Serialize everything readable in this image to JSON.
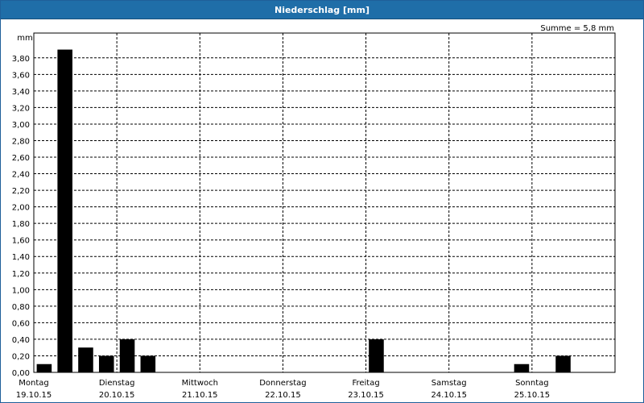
{
  "window": {
    "title": "Niederschlag [mm]"
  },
  "summary": "Summe = 5,8 mm",
  "chart_data": {
    "type": "bar",
    "title": "Niederschlag [mm]",
    "ylabel": "mm",
    "ylim": [
      0,
      4.1
    ],
    "yticks": [
      0,
      0.2,
      0.4,
      0.6,
      0.8,
      1.0,
      1.2,
      1.4,
      1.6,
      1.8,
      2.0,
      2.2,
      2.4,
      2.6,
      2.8,
      3.0,
      3.2,
      3.4,
      3.6,
      3.8
    ],
    "ytick_labels": [
      "0,00",
      "0,20",
      "0,40",
      "0,60",
      "0,80",
      "1,00",
      "1,20",
      "1,40",
      "1,60",
      "1,80",
      "2,00",
      "2,20",
      "2,40",
      "2,60",
      "2,80",
      "3,00",
      "3,20",
      "3,40",
      "3,60",
      "3,80"
    ],
    "x_day_labels": [
      {
        "day": "Montag",
        "date": "19.10.15"
      },
      {
        "day": "Dienstag",
        "date": "20.10.15"
      },
      {
        "day": "Mittwoch",
        "date": "21.10.15"
      },
      {
        "day": "Donnerstag",
        "date": "22.10.15"
      },
      {
        "day": "Freitag",
        "date": "23.10.15"
      },
      {
        "day": "Samstag",
        "date": "24.10.15"
      },
      {
        "day": "Sonntag",
        "date": "25.10.15"
      }
    ],
    "periods_per_day": 4,
    "values": [
      0.1,
      3.9,
      0.3,
      0.2,
      0.4,
      0.2,
      0,
      0,
      0,
      0,
      0,
      0,
      0,
      0,
      0,
      0,
      0.4,
      0,
      0,
      0,
      0,
      0,
      0,
      0.1,
      0,
      0.2,
      0,
      0
    ],
    "grid": true,
    "bar_color": "#000000"
  }
}
